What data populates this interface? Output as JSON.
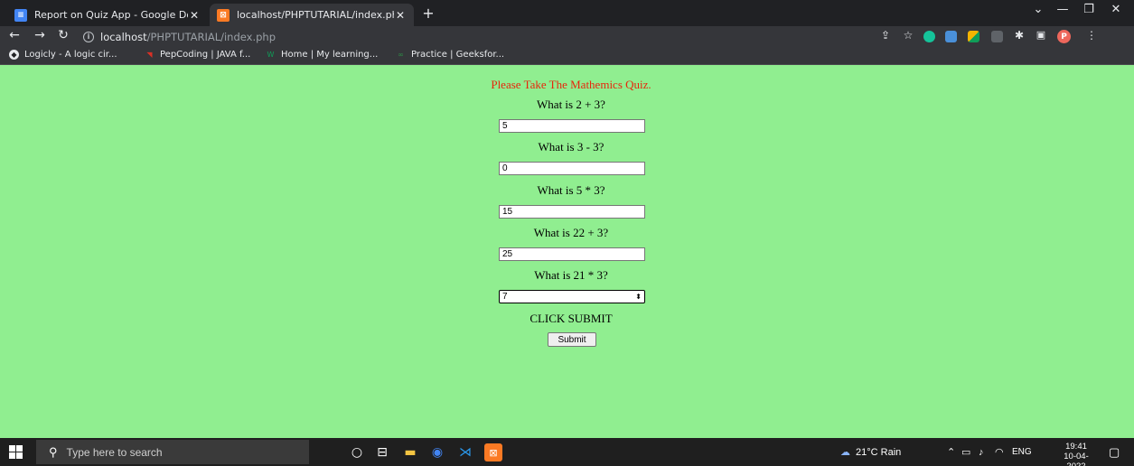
{
  "browser": {
    "tabs": [
      {
        "title": "Report on Quiz App - Google Do",
        "favicon": "google-docs-icon",
        "active": false
      },
      {
        "title": "localhost/PHPTUTARIAL/index.ph",
        "favicon": "xampp-icon",
        "active": true
      }
    ],
    "new_tab": "+",
    "window_controls": {
      "minimize": "—",
      "maximize": "❐",
      "close": "✕",
      "tab_search": "⌄"
    },
    "nav": {
      "back": "←",
      "forward": "→",
      "reload": "↻"
    },
    "url": {
      "host": "localhost",
      "path": "/PHPTUTARIAL/index.php"
    },
    "bookmarks": [
      {
        "label": "Logicly - A logic cir...",
        "icon": "logicly-icon"
      },
      {
        "label": "PepCoding | JAVA f...",
        "icon": "pepcoding-icon"
      },
      {
        "label": "Home | My learning...",
        "icon": "w3-icon"
      },
      {
        "label": "Practice | Geeksfor...",
        "icon": "geeksforgeeks-icon"
      }
    ],
    "profile_initial": "P"
  },
  "quiz": {
    "heading": "Please Take The Mathemics Quiz.",
    "questions": [
      {
        "text": "What is 2 + 3?",
        "answer": "5"
      },
      {
        "text": "What is 3 - 3?",
        "answer": "0"
      },
      {
        "text": "What is 5 * 3?",
        "answer": "15"
      },
      {
        "text": "What is 22 + 3?",
        "answer": "25"
      },
      {
        "text": "What is 21 * 3?",
        "answer": "7"
      }
    ],
    "cta": "CLICK SUBMIT",
    "submit_label": "Submit"
  },
  "taskbar": {
    "search_placeholder": "Type here to search",
    "weather": "21°C  Rain",
    "language": "ENG",
    "time": "19:41",
    "date": "10-04-2022"
  }
}
